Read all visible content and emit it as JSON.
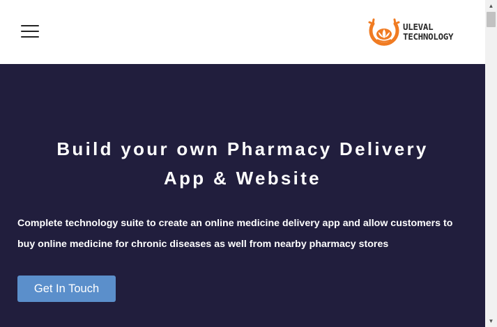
{
  "header": {
    "menu_icon": "hamburger-menu-icon",
    "logo": {
      "line1": "ULEVAL",
      "line2": "TECHNOLOGY",
      "icon": "lotus-logo-icon",
      "color_orange": "#f07b22"
    }
  },
  "hero": {
    "title_line1": "Build your own Pharmacy Delivery",
    "title_line2": "App & Website",
    "description": "Complete technology suite to create an online medicine delivery app and allow customers to buy online medicine for chronic diseases as well from nearby pharmacy stores",
    "cta_label": "Get In Touch",
    "background_color": "#211e3d",
    "cta_color": "#5b8fcb"
  },
  "scrollbar": {
    "up_icon": "scroll-up-arrow-icon",
    "down_icon": "scroll-down-arrow-icon"
  }
}
